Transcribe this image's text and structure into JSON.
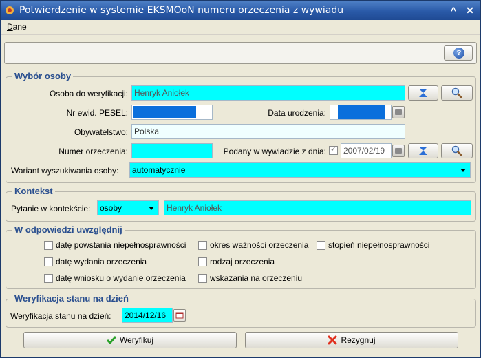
{
  "window": {
    "title": "Potwierdzenie w systemie EKSMOoN numeru orzeczenia z wywiadu",
    "minimize_glyph": "^",
    "close_glyph": "✕"
  },
  "menu": {
    "dane_first": "D",
    "dane_rest": "ane"
  },
  "toolbar": {
    "help_label": "?"
  },
  "wybor_osoby": {
    "title": "Wybór osoby",
    "osoba_label": "Osoba do weryfikacji:",
    "osoba_value": "Henryk Aniołek",
    "pesel_label": "Nr ewid. PESEL:",
    "data_urodzenia_label": "Data urodzenia:",
    "obywatelstwo_label": "Obywatelstwo:",
    "obywatelstwo_value": "Polska",
    "numer_orzeczenia_label": "Numer orzeczenia:",
    "podany_label": "Podany w wywiadzie z dnia:",
    "podany_checked": true,
    "podany_date": "2007/02/19",
    "wariant_label": "Wariant wyszukiwania osoby:",
    "wariant_value": "automatycznie"
  },
  "kontekst": {
    "title": "Kontekst",
    "pytanie_label": "Pytanie w kontekście:",
    "pytanie_value": "osoby",
    "pytanie_text": "Henryk Aniołek"
  },
  "odpowiedz": {
    "title": "W odpowiedzi uwzględnij",
    "options": [
      {
        "label": "datę powstania niepełnosprawności",
        "checked": false
      },
      {
        "label": "okres ważności orzeczenia",
        "checked": false
      },
      {
        "label": "stopień niepełnosprawności",
        "checked": false
      },
      {
        "label": "datę wydania orzeczenia",
        "checked": false
      },
      {
        "label": "rodzaj orzeczenia",
        "checked": false
      },
      {
        "label": "datę wniosku o wydanie orzeczenia",
        "checked": false
      },
      {
        "label": "wskazania na orzeczeniu",
        "checked": false
      }
    ]
  },
  "weryfikacja": {
    "title": "Weryfikacja stanu na dzień",
    "label": "Weryfikacja stanu na dzień:",
    "date": "2014/12/16"
  },
  "buttons": {
    "weryfikuj_first": "W",
    "weryfikuj_rest": "eryfikuj",
    "rezygnuj_pre": "Rezyg",
    "rezygnuj_u": "n",
    "rezygnuj_post": "uj"
  },
  "colors": {
    "accent_cyan": "#00ffff",
    "pesel_blue": "#0a6fdc",
    "group_title": "#2a4f8f"
  }
}
